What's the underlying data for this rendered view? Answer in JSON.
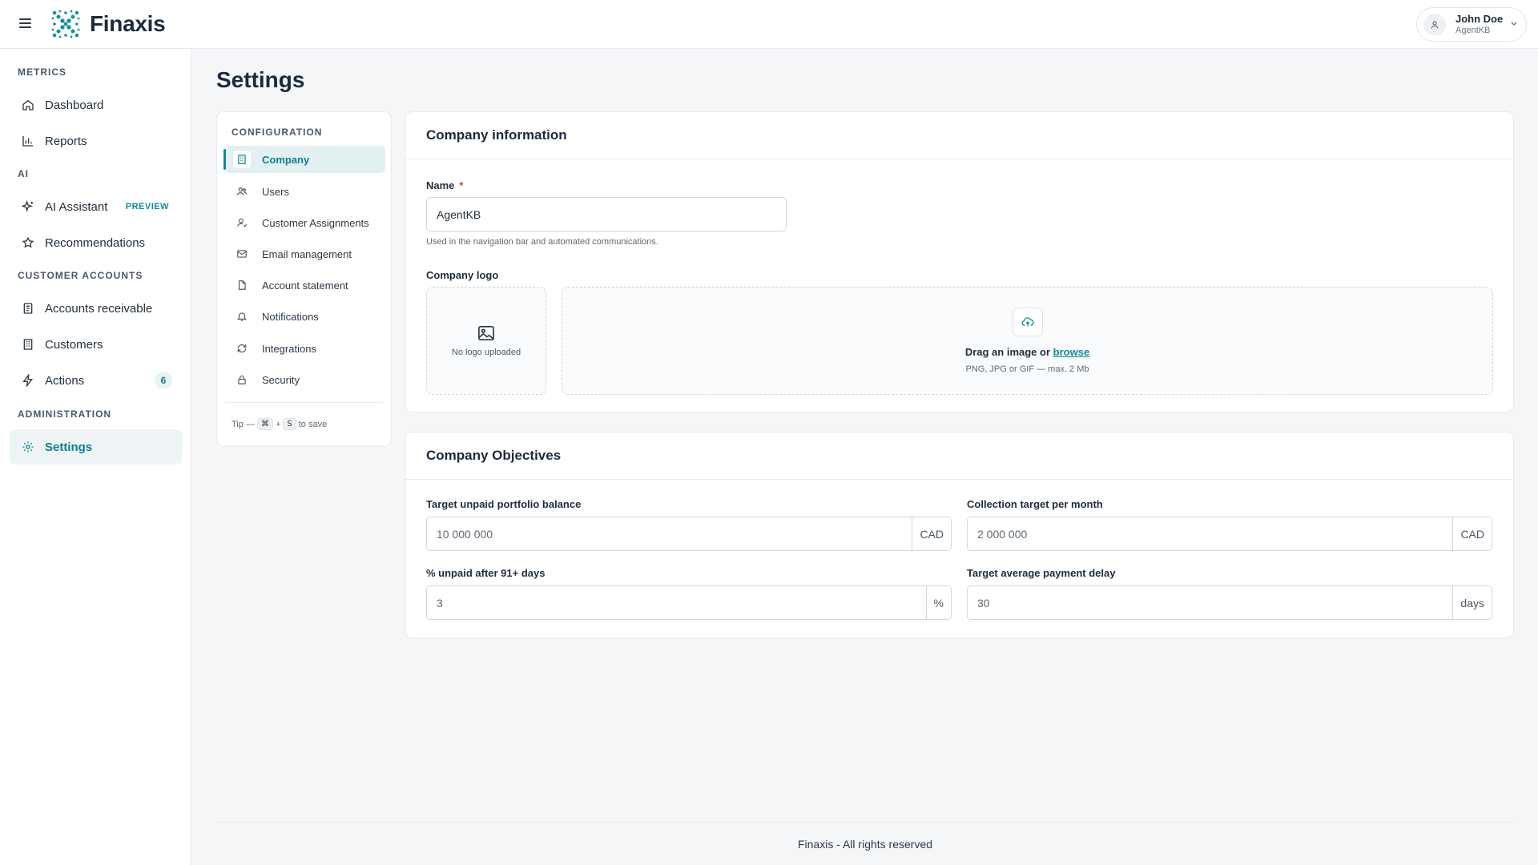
{
  "app": {
    "brand": "Finaxis",
    "user": {
      "name": "John Doe",
      "org": "AgentKB"
    }
  },
  "sidebar": {
    "sections": [
      {
        "title": "METRICS"
      },
      {
        "title": "AI"
      },
      {
        "title": "CUSTOMER ACCOUNTS"
      },
      {
        "title": "ADMINISTRATION"
      }
    ],
    "items": [
      {
        "label": "Dashboard",
        "icon": "home-icon"
      },
      {
        "label": "Reports",
        "icon": "bar-chart-icon"
      },
      {
        "label": "AI Assistant",
        "icon": "sparkles-icon",
        "badge": "PREVIEW"
      },
      {
        "label": "Recommendations",
        "icon": "star-icon"
      },
      {
        "label": "Accounts receivable",
        "icon": "receipt-icon"
      },
      {
        "label": "Customers",
        "icon": "building-icon"
      },
      {
        "label": "Actions",
        "icon": "lightning-icon",
        "count": "6"
      },
      {
        "label": "Settings",
        "icon": "gear-icon",
        "active": true
      }
    ]
  },
  "page": {
    "title": "Settings"
  },
  "config": {
    "heading": "CONFIGURATION",
    "items": [
      {
        "label": "Company",
        "icon": "building-icon",
        "active": true
      },
      {
        "label": "Users",
        "icon": "users-icon"
      },
      {
        "label": "Customer Assignments",
        "icon": "user-assign-icon"
      },
      {
        "label": "Email management",
        "icon": "mail-icon"
      },
      {
        "label": "Account statement",
        "icon": "file-icon"
      },
      {
        "label": "Notifications",
        "icon": "bell-icon"
      },
      {
        "label": "Integrations",
        "icon": "refresh-icon"
      },
      {
        "label": "Security",
        "icon": "lock-icon"
      }
    ],
    "tip": {
      "prefix": "Tip —",
      "key1": "⌘",
      "plus": "+",
      "key2": "S",
      "suffix": "to save"
    }
  },
  "company_info": {
    "title": "Company information",
    "name_label": "Name",
    "required_mark": "*",
    "name_value": "AgentKB",
    "name_help": "Used in the navigation bar and automated communications.",
    "logo_label": "Company logo",
    "no_logo": "No logo uploaded",
    "drop_text": "Drag an image or",
    "browse": "browse",
    "drop_sub": "PNG, JPG or GIF — max. 2 Mb"
  },
  "objectives": {
    "title": "Company Objectives",
    "fields": [
      {
        "label": "Target unpaid portfolio balance",
        "value": "10 000 000",
        "unit": "CAD"
      },
      {
        "label": "Collection target per month",
        "value": "2 000 000",
        "unit": "CAD"
      },
      {
        "label": "% unpaid after 91+ days",
        "value": "3",
        "unit": "%"
      },
      {
        "label": "Target average payment delay",
        "value": "30",
        "unit": "days"
      }
    ]
  },
  "footer": {
    "text": "Finaxis - All rights reserved"
  },
  "colors": {
    "accent": "#0d8b97",
    "active_bg": "#eef4f6",
    "required": "#d23b3b"
  }
}
